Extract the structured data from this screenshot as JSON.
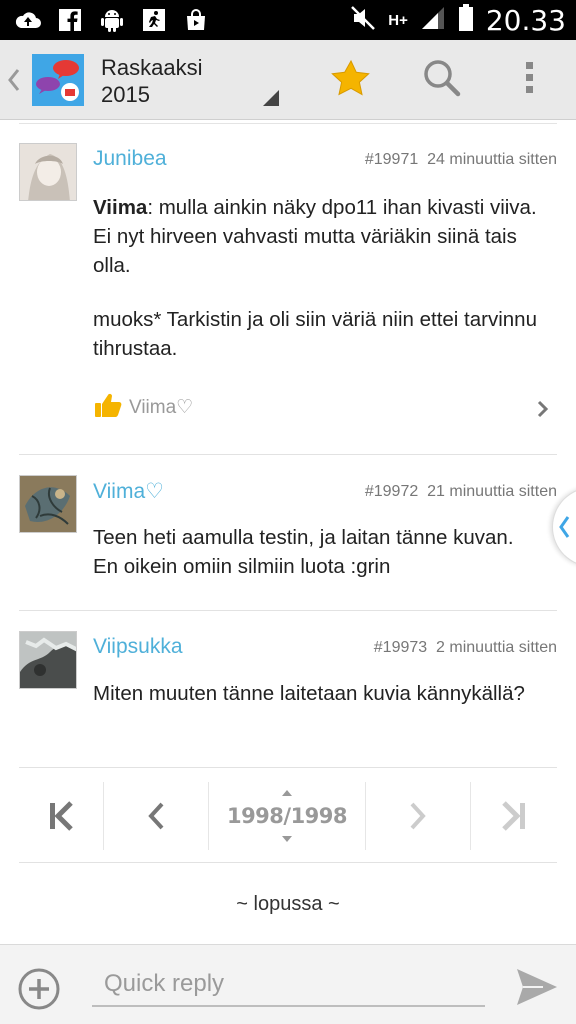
{
  "status_bar": {
    "time": "20.33",
    "network": "H+",
    "icons": [
      "cloud-upload-icon",
      "facebook-icon",
      "android-icon",
      "running-app-icon",
      "shopping-bag-icon",
      "mute-icon",
      "signal-icon",
      "battery-icon"
    ]
  },
  "action_bar": {
    "title_line1": "Raskaaksi",
    "title_line2": "2015",
    "star_color": "#f5b400"
  },
  "posts": [
    {
      "author": "Junibea",
      "number": "#19971",
      "time": "24 minuuttia sitten",
      "quote_name": "Viima",
      "body_line1": ": mulla ainkin näky dpo11 ihan kivasti viiva. Ei nyt hirveen vahvasti mutta väriäkin siinä tais olla.",
      "body_line2": "muoks* Tarkistin ja oli siin väriä niin ettei tarvinnu tihrustaa.",
      "liked_by": "Viima♡"
    },
    {
      "author": "Viima♡",
      "number": "#19972",
      "time": "21 minuuttia sitten",
      "body": "Teen heti aamulla testin, ja laitan tänne kuvan. En oikein omiin silmiin luota :grin"
    },
    {
      "author": "Viipsukka",
      "number": "#19973",
      "time": "2 minuuttia sitten",
      "body": "Miten muuten tänne laitetaan kuvia kännykällä?"
    }
  ],
  "pager": {
    "page_display": "1998/1998"
  },
  "end_label": "~ lopussa ~",
  "reply": {
    "placeholder": "Quick reply"
  },
  "colors": {
    "author": "#4fb0d9",
    "accent_blue": "#3fa6e6",
    "like_hand": "#f5b400"
  }
}
